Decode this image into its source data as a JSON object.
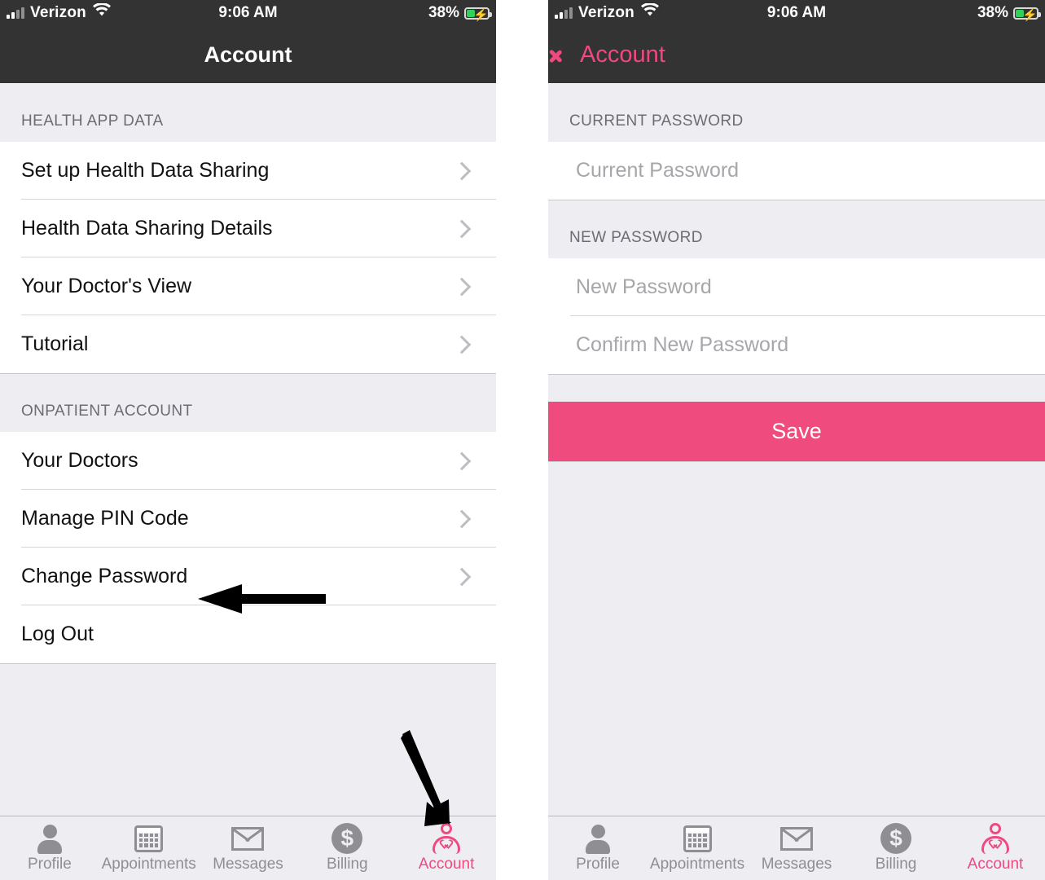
{
  "status_bar": {
    "carrier": "Verizon",
    "time": "9:06 AM",
    "battery_pct": "38%",
    "signal_icon": "signal-bars-icon",
    "wifi_icon": "wifi-icon",
    "battery_icon": "battery-charging-icon"
  },
  "colors": {
    "accent_pink": "#ef497f",
    "save_button": "#ef4b7f",
    "nav_background": "#333333",
    "group_background": "#eeeef2",
    "cell_background": "#ffffff",
    "separator": "#d5d5da",
    "muted_text": "#8e8e93",
    "placeholder_text": "#a6a6ab",
    "battery_green": "#30d158"
  },
  "left_screen": {
    "nav_title": "Account",
    "sections": [
      {
        "header": "HEALTH APP DATA",
        "rows": [
          {
            "label": "Set up Health Data Sharing",
            "accessory": "chevron-right-icon"
          },
          {
            "label": "Health Data Sharing Details",
            "accessory": "chevron-right-icon"
          },
          {
            "label": "Your Doctor's View",
            "accessory": "chevron-right-icon"
          },
          {
            "label": "Tutorial",
            "accessory": "chevron-right-icon"
          }
        ]
      },
      {
        "header": "ONPATIENT ACCOUNT",
        "rows": [
          {
            "label": "Your Doctors",
            "accessory": "chevron-right-icon"
          },
          {
            "label": "Manage PIN Code",
            "accessory": "chevron-right-icon"
          },
          {
            "label": "Change Password",
            "accessory": "chevron-right-icon"
          },
          {
            "label": "Log Out",
            "accessory": ""
          }
        ]
      }
    ],
    "annotations": [
      {
        "name": "arrow-to-change-password",
        "direction": "left"
      },
      {
        "name": "arrow-to-account-tab",
        "direction": "down-right"
      }
    ]
  },
  "right_screen": {
    "back_label": "Account",
    "back_icon": "chevron-left-icon",
    "sections": [
      {
        "header": "CURRENT PASSWORD",
        "fields": [
          {
            "placeholder": "Current Password",
            "value": ""
          }
        ]
      },
      {
        "header": "NEW PASSWORD",
        "fields": [
          {
            "placeholder": "New Password",
            "value": ""
          },
          {
            "placeholder": "Confirm New Password",
            "value": ""
          }
        ]
      }
    ],
    "save_label": "Save"
  },
  "tab_bar": {
    "tabs": [
      {
        "label": "Profile",
        "icon": "person-icon",
        "active": false
      },
      {
        "label": "Appointments",
        "icon": "calendar-icon",
        "active": false
      },
      {
        "label": "Messages",
        "icon": "envelope-icon",
        "active": false
      },
      {
        "label": "Billing",
        "icon": "dollar-circle-icon",
        "active": false
      },
      {
        "label": "Account",
        "icon": "person-heart-icon",
        "active": true
      }
    ],
    "billing_symbol": "$"
  }
}
